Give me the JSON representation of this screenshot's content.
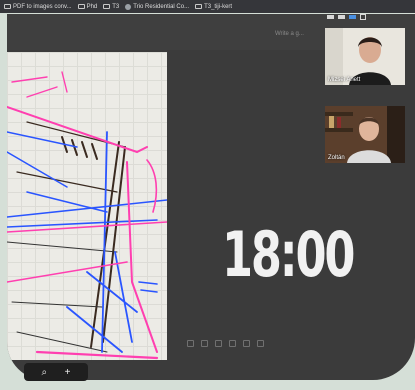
{
  "bookmarks": [
    {
      "label": "PDF to images conv...",
      "icon": "bookmark-icon"
    },
    {
      "label": "Phd",
      "icon": "folder-icon"
    },
    {
      "label": "T3",
      "icon": "folder-icon"
    },
    {
      "label": "Trio Residential Co...",
      "icon": "site-icon"
    },
    {
      "label": "T3_tiji-kert",
      "icon": "folder-icon"
    }
  ],
  "toolbar": {
    "write_placeholder": "Write a g..."
  },
  "timer": {
    "value": "18:00"
  },
  "participants": [
    {
      "name": "Mizsei Anett"
    },
    {
      "name": "Zoltán"
    }
  ],
  "zoom_controls": {
    "zoom_in": "+",
    "zoom_out": "⌕"
  },
  "colors": {
    "accent": "#4a90e2",
    "timer_text": "#f1f1f1",
    "sketch_pink": "#ff3fb0",
    "sketch_blue": "#2a55ff"
  }
}
